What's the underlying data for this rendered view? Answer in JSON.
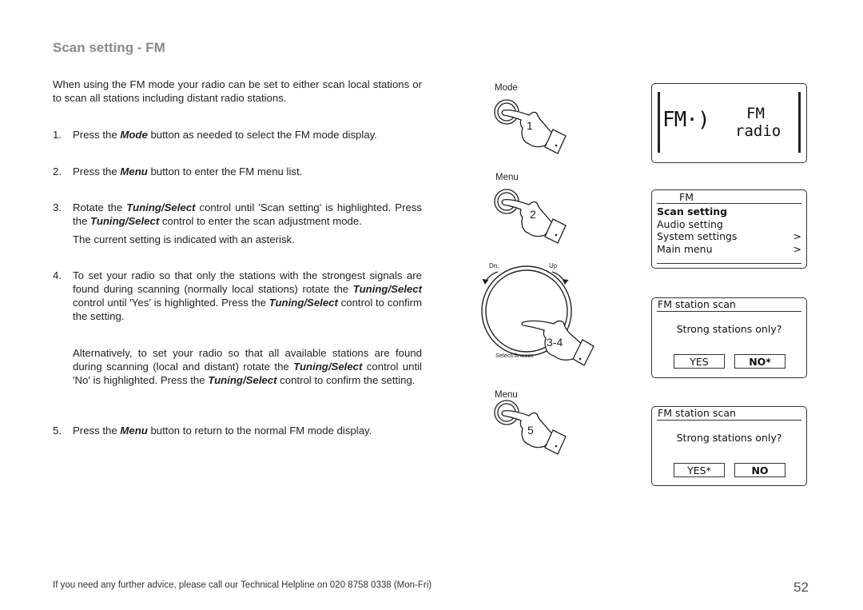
{
  "page": {
    "title": "Scan setting - FM",
    "intro": "When using the FM mode your radio can be set to either scan local stations or to scan all stations including distant radio stations.",
    "steps": [
      {
        "num": "1.",
        "parts": [
          "Press the ",
          "Mode",
          " button as needed to select the FM mode display."
        ]
      },
      {
        "num": "2.",
        "parts": [
          "Press the ",
          "Menu",
          " button to enter the FM menu list."
        ]
      },
      {
        "num": "3.",
        "parts": [
          "Rotate the ",
          "Tuning/Select",
          " control until 'Scan setting' is highlighted. Press the ",
          "Tuning/Select",
          " control to enter the scan adjustment mode."
        ],
        "note": "The current setting is indicated with an asterisk."
      },
      {
        "num": "4.",
        "parts": [
          "To set your radio so that only the stations with the strongest signals are found during scanning (normally local stations) rotate the ",
          "Tuning/Select",
          " control until 'Yes' is highlighted. Press the ",
          "Tuning/Select",
          " control to confirm the setting."
        ],
        "alt_parts": [
          "Alternatively, to set your radio so that all available stations are found during scanning (local and distant) rotate the ",
          "Tuning/Select",
          " control until 'No' is highlighted. Press the ",
          "Tuning/Select",
          " control to confirm the setting."
        ]
      },
      {
        "num": "5.",
        "parts": [
          "Press the ",
          "Menu",
          " button to return to the normal FM mode display."
        ]
      }
    ],
    "footer": "If you need any further advice, please call our Technical Helpline on 020 8758 0338 (Mon-Fri)",
    "page_number": "52"
  },
  "illustrations": {
    "mode_button": {
      "label": "Mode",
      "step": "1",
      "icon": "hand-pressing-button-icon"
    },
    "menu_button": {
      "label": "Menu",
      "step": "2",
      "icon": "hand-pressing-button-icon"
    },
    "tuning_dial": {
      "label_down": "Dn.",
      "label_up": "Up",
      "label_bottom": "Select/Snooze",
      "step": "3-4",
      "icon": "hand-pressing-dial-icon"
    },
    "menu_button_2": {
      "label": "Menu",
      "step": "5",
      "icon": "hand-pressing-button-icon"
    }
  },
  "displays": {
    "fm_mode": {
      "icon_text": "FM·)",
      "line1": "FM",
      "line2": "radio"
    },
    "fm_menu": {
      "header": "FM",
      "items": [
        {
          "label": "Scan setting",
          "arrow": "",
          "selected": true
        },
        {
          "label": "Audio setting",
          "arrow": "",
          "selected": false
        },
        {
          "label": "System settings",
          "arrow": ">",
          "selected": false
        },
        {
          "label": "Main menu",
          "arrow": ">",
          "selected": false
        }
      ]
    },
    "scan_no": {
      "header": "FM station scan",
      "question": "Strong stations only?",
      "yes": "YES",
      "no": "NO*",
      "selected": "no"
    },
    "scan_yes": {
      "header": "FM station scan",
      "question": "Strong stations only?",
      "yes": "YES*",
      "no": "NO",
      "selected": "no"
    }
  },
  "colors": {
    "title": "#8a8a8a",
    "text": "#222222"
  }
}
